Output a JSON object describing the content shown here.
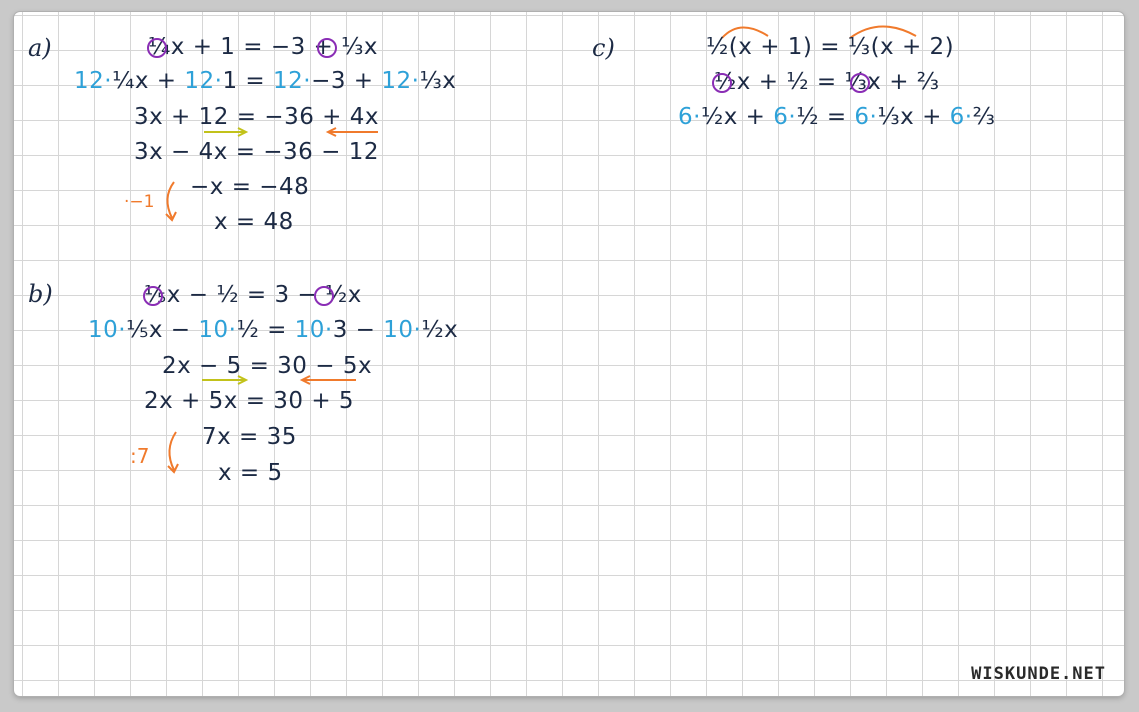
{
  "labels": {
    "a": "a)",
    "b": "b)",
    "c": "c)"
  },
  "part_a": {
    "l1": "¼x + 1 = −3 + ⅓x",
    "l2_pre": "12·",
    "l2_t1": "¼x + ",
    "l2_m1": "12·",
    "l2_t2": "1 = ",
    "l2_m2": "12·",
    "l2_t3": "−3 + ",
    "l2_m3": "12·",
    "l2_t4": "⅓x",
    "l3": "3x + 12 = −36 + 4x",
    "l4": "3x − 4x = −36 − 12",
    "l5": "−x = −48",
    "l6": "x = 48",
    "op": "·−1"
  },
  "part_b": {
    "l1": "⅕x − ½ = 3 − ½x",
    "l2_m1": "10·",
    "l2_t1": "⅕x − ",
    "l2_m2": "10·",
    "l2_t2": "½ = ",
    "l2_m3": "10·",
    "l2_t3": "3 − ",
    "l2_m4": "10·",
    "l2_t4": "½x",
    "l3": "2x − 5 = 30 − 5x",
    "l4": "2x + 5x = 30 + 5",
    "l5": "7x = 35",
    "l6": "x = 5",
    "op": ":7"
  },
  "part_c": {
    "l1": "½(x + 1) = ⅓(x + 2)",
    "l2": "½x + ½ = ⅓x + ⅔",
    "l3_m1": "6·",
    "l3_t1": "½x + ",
    "l3_m2": "6·",
    "l3_t2": "½ = ",
    "l3_m3": "6·",
    "l3_t3": "⅓x + ",
    "l3_m4": "6·",
    "l3_t4": "⅔"
  },
  "watermark": "WISKUNDE.NET",
  "colors": {
    "ink": "#1c2a44",
    "blue": "#2ea1d8",
    "orange": "#f07a2c",
    "purple": "#8a2db5",
    "olive": "#c2c21a"
  }
}
